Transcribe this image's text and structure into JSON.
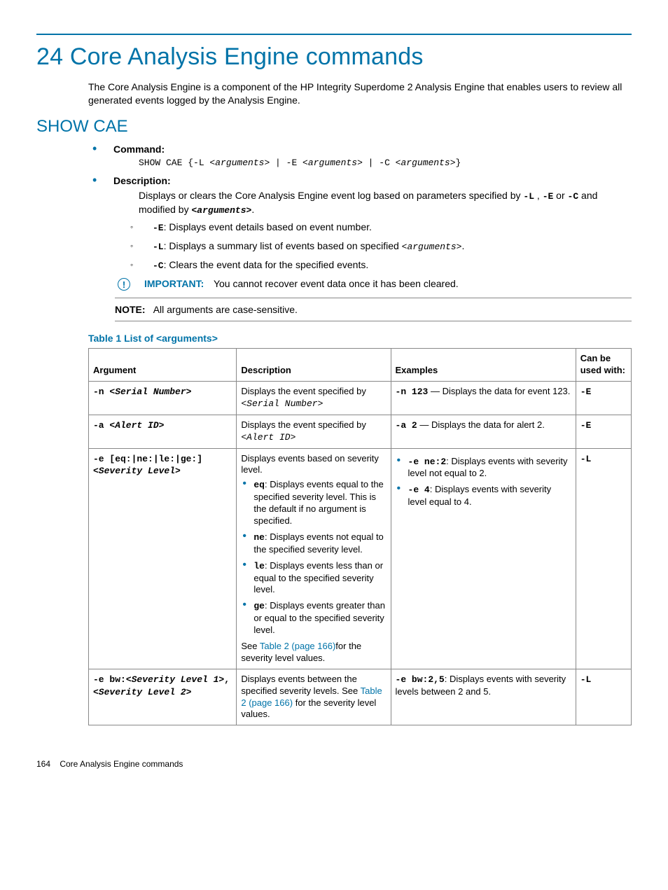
{
  "chapter": {
    "number": "24",
    "title": "Core Analysis Engine commands",
    "intro": "The Core Analysis Engine is a component of the HP Integrity Superdome 2 Analysis Engine that enables users to review all generated events logged by the Analysis Engine."
  },
  "section": {
    "heading": "SHOW CAE",
    "command_label": "Command:",
    "syntax_prefix": "SHOW CAE {-L <",
    "syntax_arg1": "arguments",
    "syntax_mid1": "> | -E <",
    "syntax_arg2": "arguments",
    "syntax_mid2": "> | -C <",
    "syntax_arg3": "arguments",
    "syntax_suffix": ">}",
    "description_label": "Description:",
    "description_intro_pre": "Displays or clears the Core Analysis Engine event log based on parameters specified by ",
    "description_flag_L": "-L",
    "description_intro_mid1": " , ",
    "description_flag_E": "-E",
    "description_intro_mid2": " or ",
    "description_flag_C": "-C",
    "description_intro_mid3": " and modified by ",
    "description_args": "<arguments>",
    "description_intro_end": ".",
    "bullets": {
      "e_flag": "-E",
      "e_text": ": Displays event details based on event number.",
      "l_flag": "-L",
      "l_text_pre": ": Displays a summary list of events based on specified ",
      "l_arg": "<arguments>",
      "l_text_post": ".",
      "c_flag": "-C",
      "c_text": ": Clears the event data for the specified events."
    },
    "important_label": "IMPORTANT:",
    "important_text": "You cannot recover event data once it has been cleared.",
    "note_label": "NOTE:",
    "note_text": "All arguments are case-sensitive."
  },
  "table": {
    "caption": "Table 1 List of <arguments>",
    "headers": {
      "arg": "Argument",
      "desc": "Description",
      "ex": "Examples",
      "used": "Can be used with:"
    },
    "rows": {
      "r1": {
        "arg_prefix": "-n ",
        "arg_var": "<Serial Number>",
        "desc_pre": "Displays the event specified by ",
        "desc_var": "<Serial Number>",
        "ex_code": "-n 123",
        "ex_dash": " — ",
        "ex_text": "Displays the data for event 123.",
        "used": "-E"
      },
      "r2": {
        "arg_prefix": "-a ",
        "arg_var": "<Alert ID>",
        "desc_pre": "Displays the event specified by ",
        "desc_var": "<Alert ID>",
        "ex_code": "-a 2",
        "ex_dash": " — ",
        "ex_text": "Displays the data for alert 2.",
        "used": "-E"
      },
      "r3": {
        "arg_line1": "-e [eq:|ne:|le:|ge:]",
        "arg_line2": "<Severity Level>",
        "desc_intro": "Displays events based on severity level.",
        "li_eq_code": "eq",
        "li_eq_text": ": Displays events equal to the specified severity level. This is the default if no argument is specified.",
        "li_ne_code": "ne",
        "li_ne_text": ": Displays events not equal to the specified severity level.",
        "li_le_code": "le",
        "li_le_text": ": Displays events less than or equal to the specified severity level.",
        "li_ge_code": "ge",
        "li_ge_text": ": Displays events greater than or equal to the specified severity level.",
        "see_pre": "See ",
        "see_link": "Table 2 (page 166)",
        "see_post": "for the severity level values.",
        "ex1_code": "-e ne:2",
        "ex1_text": ": Displays events with severity level not equal to 2.",
        "ex2_code": "-e 4",
        "ex2_text": ": Displays events with severity level equal to 4.",
        "used": "-L"
      },
      "r4": {
        "arg_prefix": "-e bw:",
        "arg_var1": "<Severity Level 1>",
        "arg_comma": ",",
        "arg_var2": "<Severity Level 2>",
        "desc_pre": "Displays events between the specified severity levels. See ",
        "desc_link": "Table 2 (page 166)",
        "desc_post": " for the severity level values.",
        "ex_code": "-e bw:2,5",
        "ex_text": ": Displays events with severity levels between 2 and 5.",
        "used": "-L"
      }
    }
  },
  "footer": {
    "page": "164",
    "title": "Core Analysis Engine commands"
  }
}
